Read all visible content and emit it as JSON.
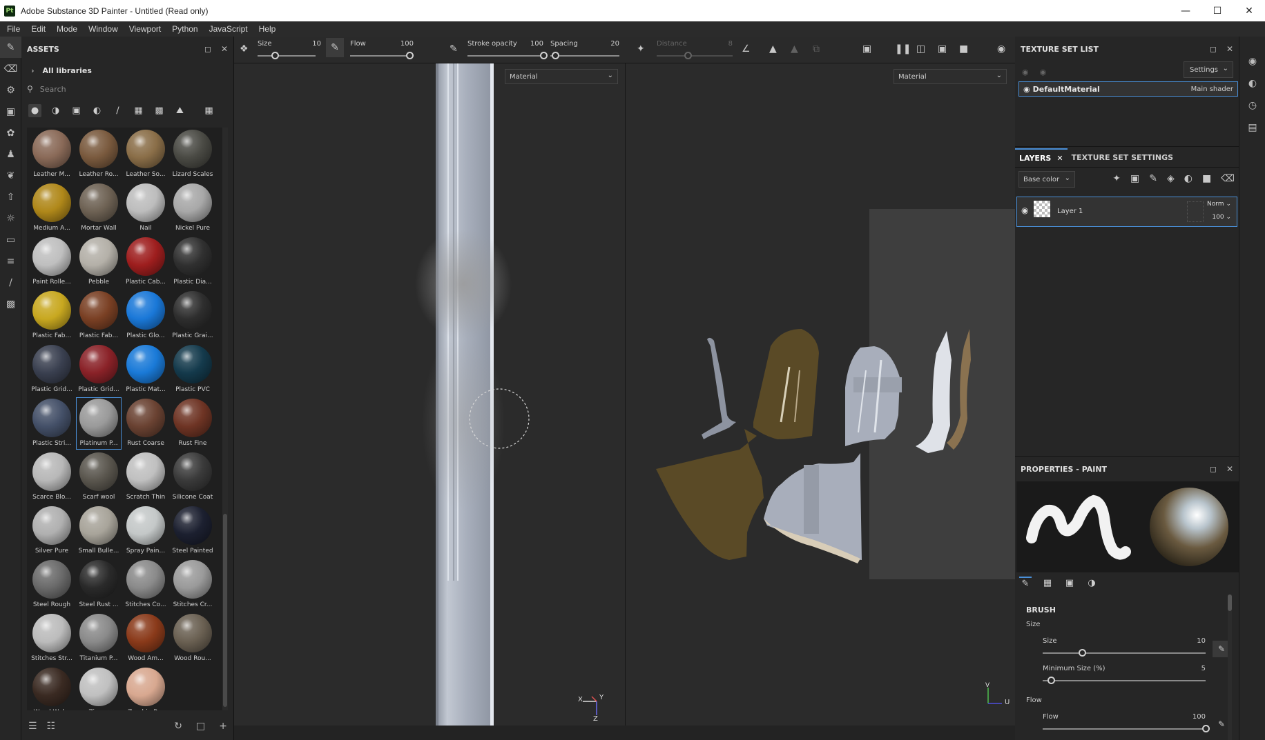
{
  "window": {
    "app_icon": "Pt",
    "title": "Adobe Substance 3D Painter - Untitled (Read only)",
    "minimize": "—",
    "maximize": "☐",
    "close": "✕"
  },
  "menu": [
    "File",
    "Edit",
    "Mode",
    "Window",
    "Viewport",
    "Python",
    "JavaScript",
    "Help"
  ],
  "assets": {
    "title": "ASSETS",
    "library": "All libraries",
    "search_placeholder": "Search",
    "items": [
      {
        "label": "Leather M...",
        "color": "#8a6a58"
      },
      {
        "label": "Leather Ro...",
        "color": "#7a5a3e"
      },
      {
        "label": "Leather So...",
        "color": "#8a6e48"
      },
      {
        "label": "Lizard Scales",
        "color": "#4a4a44"
      },
      {
        "label": "Medium A...",
        "color": "#b0881a"
      },
      {
        "label": "Mortar Wall",
        "color": "#6e6254"
      },
      {
        "label": "Nail",
        "color": "#bdbdbd"
      },
      {
        "label": "Nickel Pure",
        "color": "#a8a8a8"
      },
      {
        "label": "Paint Rolle...",
        "color": "#bfbfbf"
      },
      {
        "label": "Pebble",
        "color": "#b4b0a8"
      },
      {
        "label": "Plastic Cab...",
        "color": "#9e1e1e"
      },
      {
        "label": "Plastic Dia...",
        "color": "#303030"
      },
      {
        "label": "Plastic Fab...",
        "color": "#c8a820"
      },
      {
        "label": "Plastic Fab...",
        "color": "#7a4024"
      },
      {
        "label": "Plastic Glo...",
        "color": "#1a78d8"
      },
      {
        "label": "Plastic Grai...",
        "color": "#2e2e2e"
      },
      {
        "label": "Plastic Grid...",
        "color": "#3a4050"
      },
      {
        "label": "Plastic Grid...",
        "color": "#8a2228"
      },
      {
        "label": "Plastic Mat...",
        "color": "#1a7ad8"
      },
      {
        "label": "Plastic PVC",
        "color": "#143a4c"
      },
      {
        "label": "Plastic Stri...",
        "color": "#445068"
      },
      {
        "label": "Platinum P...",
        "color": "#9a9a9a"
      },
      {
        "label": "Rust Coarse",
        "color": "#6a4232"
      },
      {
        "label": "Rust Fine",
        "color": "#6e3424"
      },
      {
        "label": "Scarce Blo...",
        "color": "#b8b8b8"
      },
      {
        "label": "Scarf wool",
        "color": "#5a564e"
      },
      {
        "label": "Scratch Thin",
        "color": "#c0c0c0"
      },
      {
        "label": "Silicone Coat",
        "color": "#3a3a3a"
      },
      {
        "label": "Silver Pure",
        "color": "#b0b0b0"
      },
      {
        "label": "Small Bulle...",
        "color": "#a8a49a"
      },
      {
        "label": "Spray Pain...",
        "color": "#c4c8c8"
      },
      {
        "label": "Steel Painted",
        "color": "#1c2030"
      },
      {
        "label": "Steel Rough",
        "color": "#6a6a6a"
      },
      {
        "label": "Steel Rust ...",
        "color": "#2a2a2a"
      },
      {
        "label": "Stitches Co...",
        "color": "#8a8a8a"
      },
      {
        "label": "Stitches Cr...",
        "color": "#9a9a9a"
      },
      {
        "label": "Stitches Str...",
        "color": "#bcbcbc"
      },
      {
        "label": "Titanium P...",
        "color": "#8a8a8a"
      },
      {
        "label": "Wood Am...",
        "color": "#8a3a1a"
      },
      {
        "label": "Wood Rou...",
        "color": "#6a6052"
      },
      {
        "label": "Wood Wal...",
        "color": "#3a2a22"
      },
      {
        "label": "Zipper",
        "color": "#c0c0c0"
      },
      {
        "label": "Zombie B...",
        "color": "#d8a890"
      }
    ],
    "selected_item": "Platinum P..."
  },
  "toolbar": {
    "size_label": "Size",
    "size_value": "10",
    "flow_label": "Flow",
    "flow_value": "100",
    "stroke_opacity_label": "Stroke opacity",
    "stroke_opacity_value": "100",
    "spacing_label": "Spacing",
    "spacing_value": "20",
    "distance_label": "Distance",
    "distance_value": "8"
  },
  "viewport": {
    "left_dropdown": "Material",
    "right_dropdown": "Material",
    "axis_x": "X",
    "axis_y": "Y",
    "axis_z": "Z",
    "uv_v": "V",
    "uv_u": "U"
  },
  "texture_set_list": {
    "title": "TEXTURE SET LIST",
    "settings": "Settings",
    "material_name": "DefaultMaterial",
    "shader": "Main shader"
  },
  "layers": {
    "tab_layers": "LAYERS",
    "tab_tss": "TEXTURE SET SETTINGS",
    "channel": "Base color",
    "layer_name": "Layer 1",
    "blend_mode": "Norm",
    "opacity": "100"
  },
  "properties": {
    "title": "PROPERTIES - PAINT",
    "section": "BRUSH",
    "size_group": "Size",
    "size_label": "Size",
    "size_value": "10",
    "size_fraction": 0.24,
    "min_size_label": "Minimum Size (%)",
    "min_size_value": "5",
    "min_size_fraction": 0.05,
    "flow_group": "Flow",
    "flow_label": "Flow",
    "flow_value": "100",
    "flow_fraction": 1.0
  },
  "colors": {
    "accent": "#4a90d9",
    "uv_brown": "#5a4a26",
    "uv_grey": "#a8aebb"
  }
}
